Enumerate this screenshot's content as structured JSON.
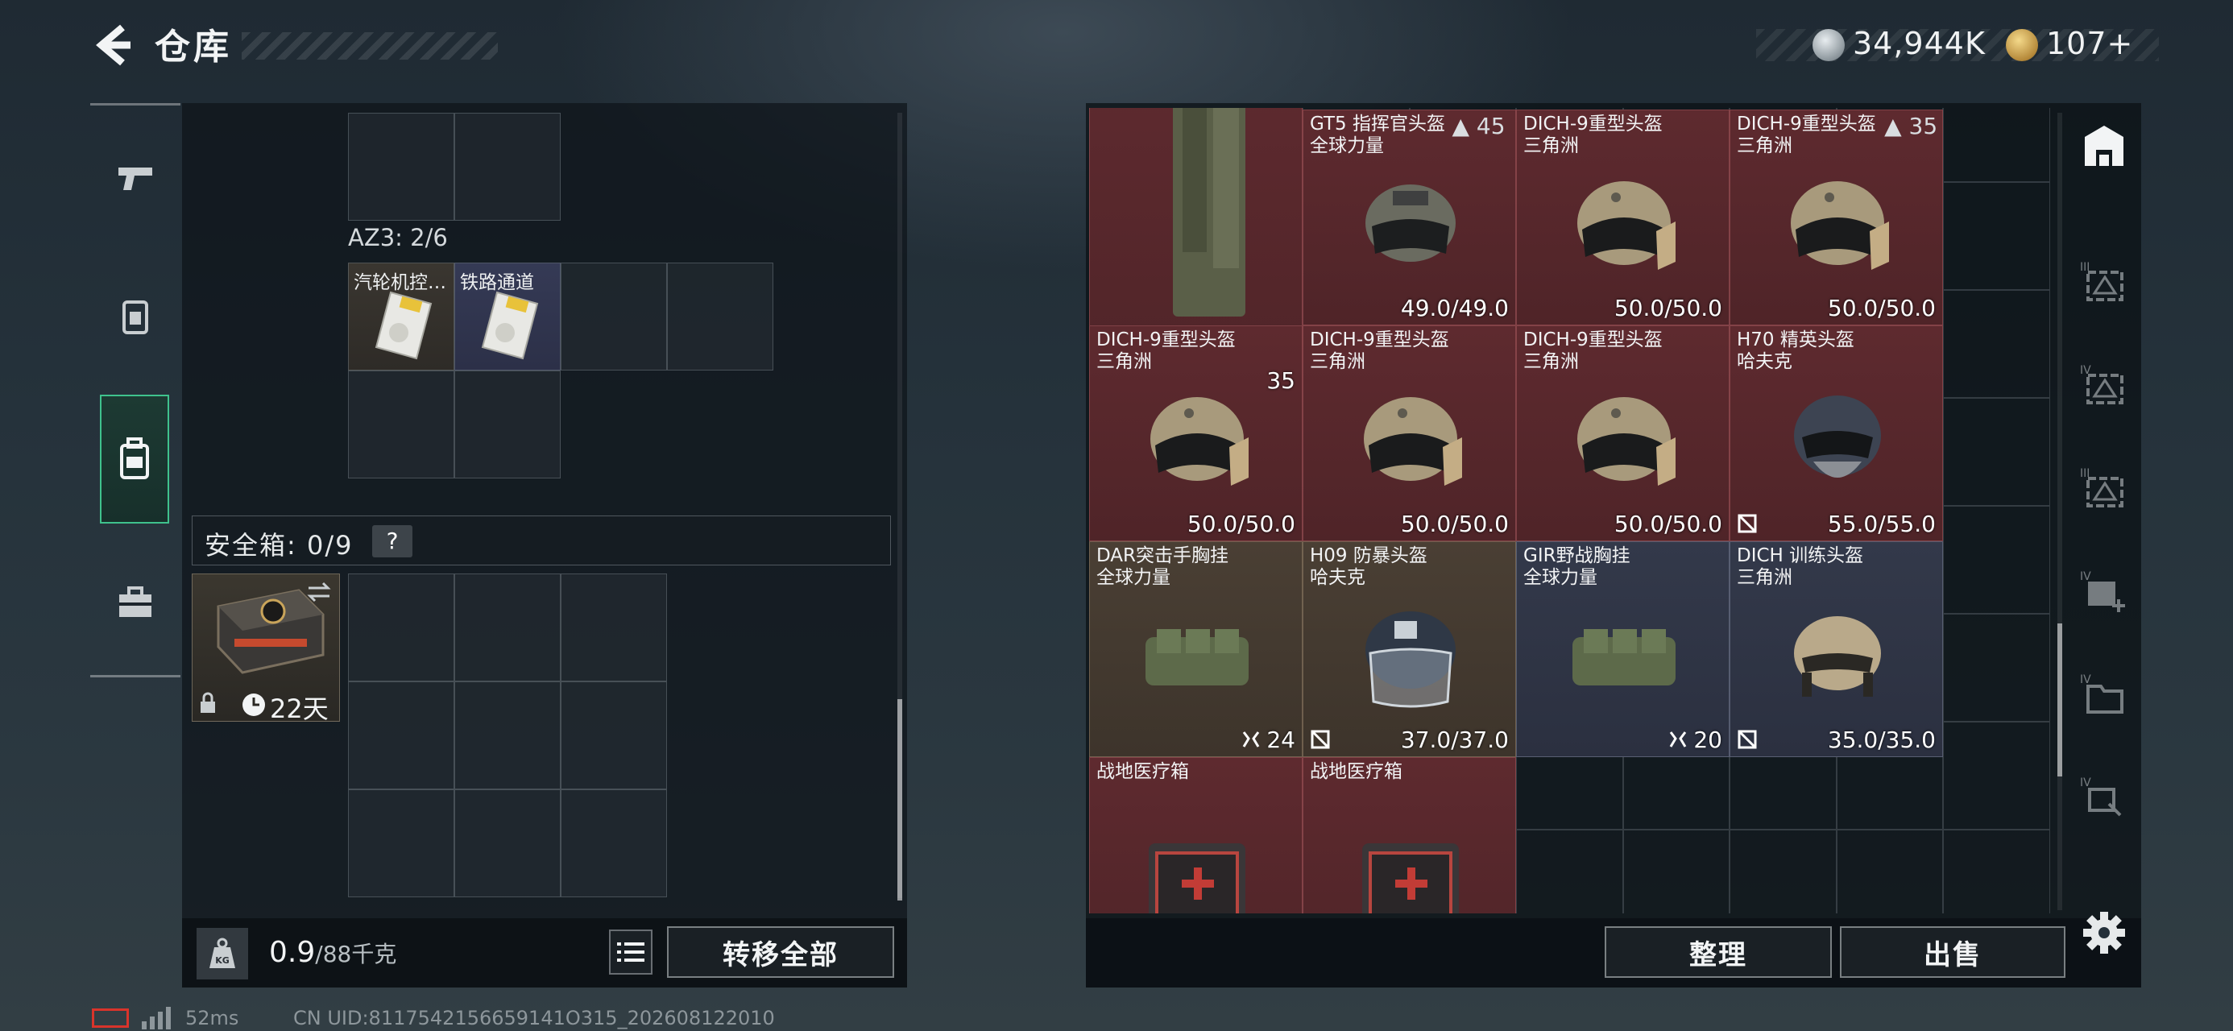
{
  "header": {
    "title": "仓库",
    "silver": "34,944K",
    "gold": "107+"
  },
  "colors": {
    "accent": "#3fc28d",
    "red_rarity": "#5e2a2f",
    "brown_rarity": "#4a3f34",
    "blue_rarity": "#33394a"
  },
  "nav": {
    "items": [
      "gun-icon",
      "armor-icon",
      "backpack-icon",
      "toolbox-icon"
    ],
    "active_index": 2
  },
  "container": {
    "label": "AZ3: 2/6",
    "items": [
      {
        "name": "汽轮机控…"
      },
      {
        "name": "铁路通道"
      }
    ]
  },
  "safe": {
    "label": "安全箱: 0/9",
    "help": "?",
    "days": "22天"
  },
  "weight": {
    "current": "0.9",
    "max": "/88千克",
    "unit_icon": "KG"
  },
  "buttons": {
    "transfer_all": "转移全部",
    "sort": "整理",
    "sell": "出售"
  },
  "stash": {
    "top_counts": [
      "45",
      "35"
    ],
    "items": [
      {
        "name1": "",
        "name2": "",
        "value": "35",
        "rarity": "red",
        "kind": "rig-tall"
      },
      {
        "name1": "GT5 指挥官头盔",
        "name2": "全球力量",
        "value": "49.0/49.0",
        "rarity": "red",
        "kind": "helmet-gt5"
      },
      {
        "name1": "DICH-9重型头盔",
        "name2": "三角洲",
        "value": "50.0/50.0",
        "rarity": "red",
        "kind": "helmet-dich"
      },
      {
        "name1": "DICH-9重型头盔",
        "name2": "三角洲",
        "value": "50.0/50.0",
        "rarity": "red",
        "kind": "helmet-dich"
      },
      {
        "name1": "DICH-9重型头盔",
        "name2": "三角洲",
        "value": "50.0/50.0",
        "rarity": "red",
        "kind": "helmet-dich"
      },
      {
        "name1": "DICH-9重型头盔",
        "name2": "三角洲",
        "value": "50.0/50.0",
        "rarity": "red",
        "kind": "helmet-dich"
      },
      {
        "name1": "DICH-9重型头盔",
        "name2": "三角洲",
        "value": "50.0/50.0",
        "rarity": "red",
        "kind": "helmet-dich"
      },
      {
        "name1": "H70 精英头盔",
        "name2": "哈夫克",
        "value": "55.0/55.0",
        "rarity": "red",
        "kind": "helmet-h70"
      },
      {
        "name1": "DAR突击手胸挂",
        "name2": "全球力量",
        "value": "24",
        "rarity": "brown",
        "kind": "rig"
      },
      {
        "name1": "H09 防暴头盔",
        "name2": "哈夫克",
        "value": "37.0/37.0",
        "rarity": "brown",
        "kind": "helmet-h09"
      },
      {
        "name1": "GIR野战胸挂",
        "name2": "全球力量",
        "value": "20",
        "rarity": "blue",
        "kind": "rig"
      },
      {
        "name1": "DICH 训练头盔",
        "name2": "三角洲",
        "value": "35.0/35.0",
        "rarity": "blue",
        "kind": "helmet-train"
      },
      {
        "name1": "战地医疗箱",
        "name2": "",
        "value": "",
        "rarity": "red",
        "kind": "medkit"
      },
      {
        "name1": "战地医疗箱",
        "name2": "",
        "value": "",
        "rarity": "red",
        "kind": "medkit"
      }
    ]
  },
  "side_tabs": [
    "storage-icon",
    "case-icon-III",
    "case-icon-IV",
    "case-icon-III-b",
    "case-add-icon-IV",
    "folder-icon-IV",
    "key-icon-IV"
  ],
  "status_bar": {
    "ping": "52ms",
    "uid": "CN UID:8117542156659141O315_202608122010"
  }
}
